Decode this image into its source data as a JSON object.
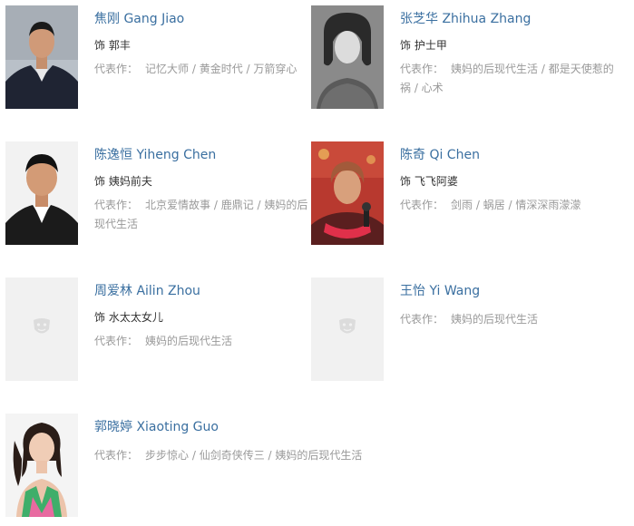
{
  "cast": [
    {
      "name": "焦刚 Gang Jiao",
      "role": "饰 郭丰",
      "works_label": "代表作：",
      "works": "记忆大师 / 黄金时代 / 万箭穿心"
    },
    {
      "name": "张芝华 Zhihua Zhang",
      "role": "饰 护士甲",
      "works_label": "代表作：",
      "works": "姨妈的后现代生活 / 都是天使惹的祸 / 心术"
    },
    {
      "name": "陈逸恒 Yiheng Chen",
      "role": "饰 姨妈前夫",
      "works_label": "代表作：",
      "works": "北京爱情故事 / 鹿鼎记 / 姨妈的后现代生活"
    },
    {
      "name": "陈奇 Qi Chen",
      "role": "饰 飞飞阿婆",
      "works_label": "代表作：",
      "works": "剑雨 / 蜗居 / 情深深雨濛濛"
    },
    {
      "name": "周爱林 Ailin Zhou",
      "role": "饰 水太太女儿",
      "works_label": "代表作：",
      "works": "姨妈的后现代生活"
    },
    {
      "name": "王怡 Yi Wang",
      "works_label": "代表作：",
      "works": "姨妈的后现代生活"
    },
    {
      "name": "郭晓婷 Xiaoting Guo",
      "works_label": "代表作：",
      "works": "步步惊心 / 仙剑奇侠传三 / 姨妈的后现代生活"
    }
  ],
  "colors": {
    "name_link": "#3a6fa0",
    "works_text": "#999999",
    "placeholder_bg": "#f1f1f1"
  }
}
